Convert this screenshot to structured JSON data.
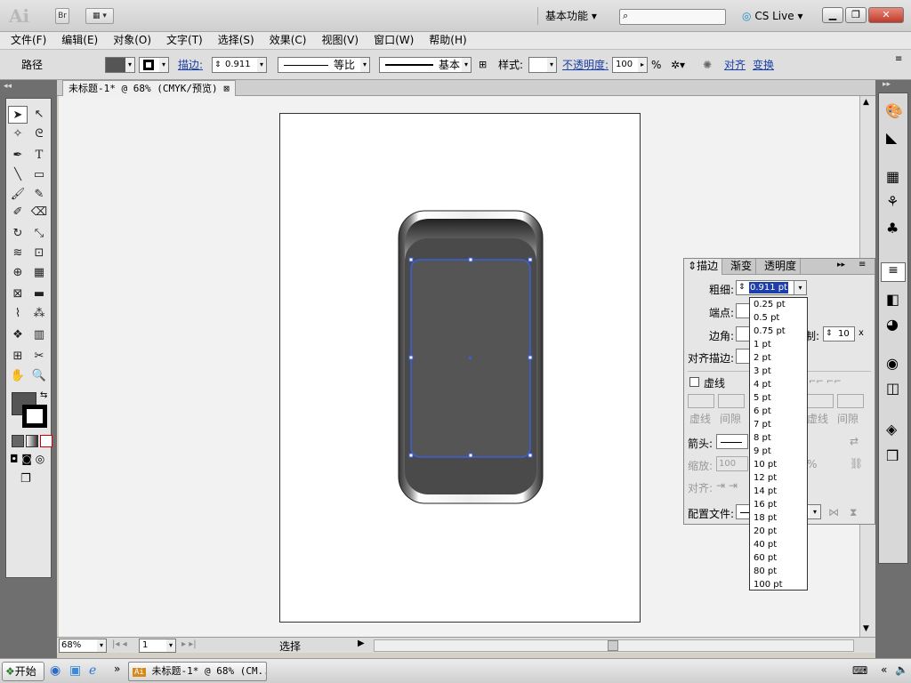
{
  "app": {
    "logo": "Ai",
    "bridge": "Br",
    "workspace": "基本功能",
    "cs_live": "CS Live"
  },
  "menu": [
    "文件(F)",
    "编辑(E)",
    "对象(O)",
    "文字(T)",
    "选择(S)",
    "效果(C)",
    "视图(V)",
    "窗口(W)",
    "帮助(H)"
  ],
  "control": {
    "path_label": "路径",
    "stroke_link": "描边:",
    "stroke_value": "0.911",
    "proportion": "等比",
    "basic": "基本",
    "style_label": "样式:",
    "opacity_link": "不透明度:",
    "opacity_value": "100",
    "opacity_unit": "%",
    "align_link": "对齐",
    "transform_link": "变换"
  },
  "doc": {
    "tab_title": "未标题-1* @ 68% (CMYK/预览)",
    "close": "⊠"
  },
  "status": {
    "zoom": "68%",
    "page": "1",
    "status_text": "选择"
  },
  "taskbar": {
    "start": "开始",
    "task": "未标题-1* @ 68% (CM..."
  },
  "stroke_panel": {
    "tabs": [
      "描边",
      "渐变",
      "透明度"
    ],
    "weight_label": "粗细:",
    "weight_value": "0.911 pt",
    "cap_label": "端点:",
    "corner_label": "边角:",
    "limit_label": "制:",
    "limit_value": "10",
    "limit_x": "x",
    "align_label": "对齐描边:",
    "dashed_label": "虚线",
    "dash_label": "虚线",
    "gap_label": "间隙",
    "arrow_label": "箭头:",
    "scale_label": "缩放:",
    "scale_value": "100",
    "scale_unit": "%",
    "align2_label": "对齐:",
    "profile_label": "配置文件:"
  },
  "weight_options": [
    "0.25 pt",
    "0.5 pt",
    "0.75 pt",
    "1 pt",
    "2 pt",
    "3 pt",
    "4 pt",
    "5 pt",
    "6 pt",
    "7 pt",
    "8 pt",
    "9 pt",
    "10 pt",
    "12 pt",
    "14 pt",
    "16 pt",
    "18 pt",
    "20 pt",
    "40 pt",
    "60 pt",
    "80 pt",
    "100 pt"
  ],
  "colors": {
    "fill_swatch": "#555555",
    "selection": "#3a5fd9",
    "device_body": "#4a4a4a"
  }
}
